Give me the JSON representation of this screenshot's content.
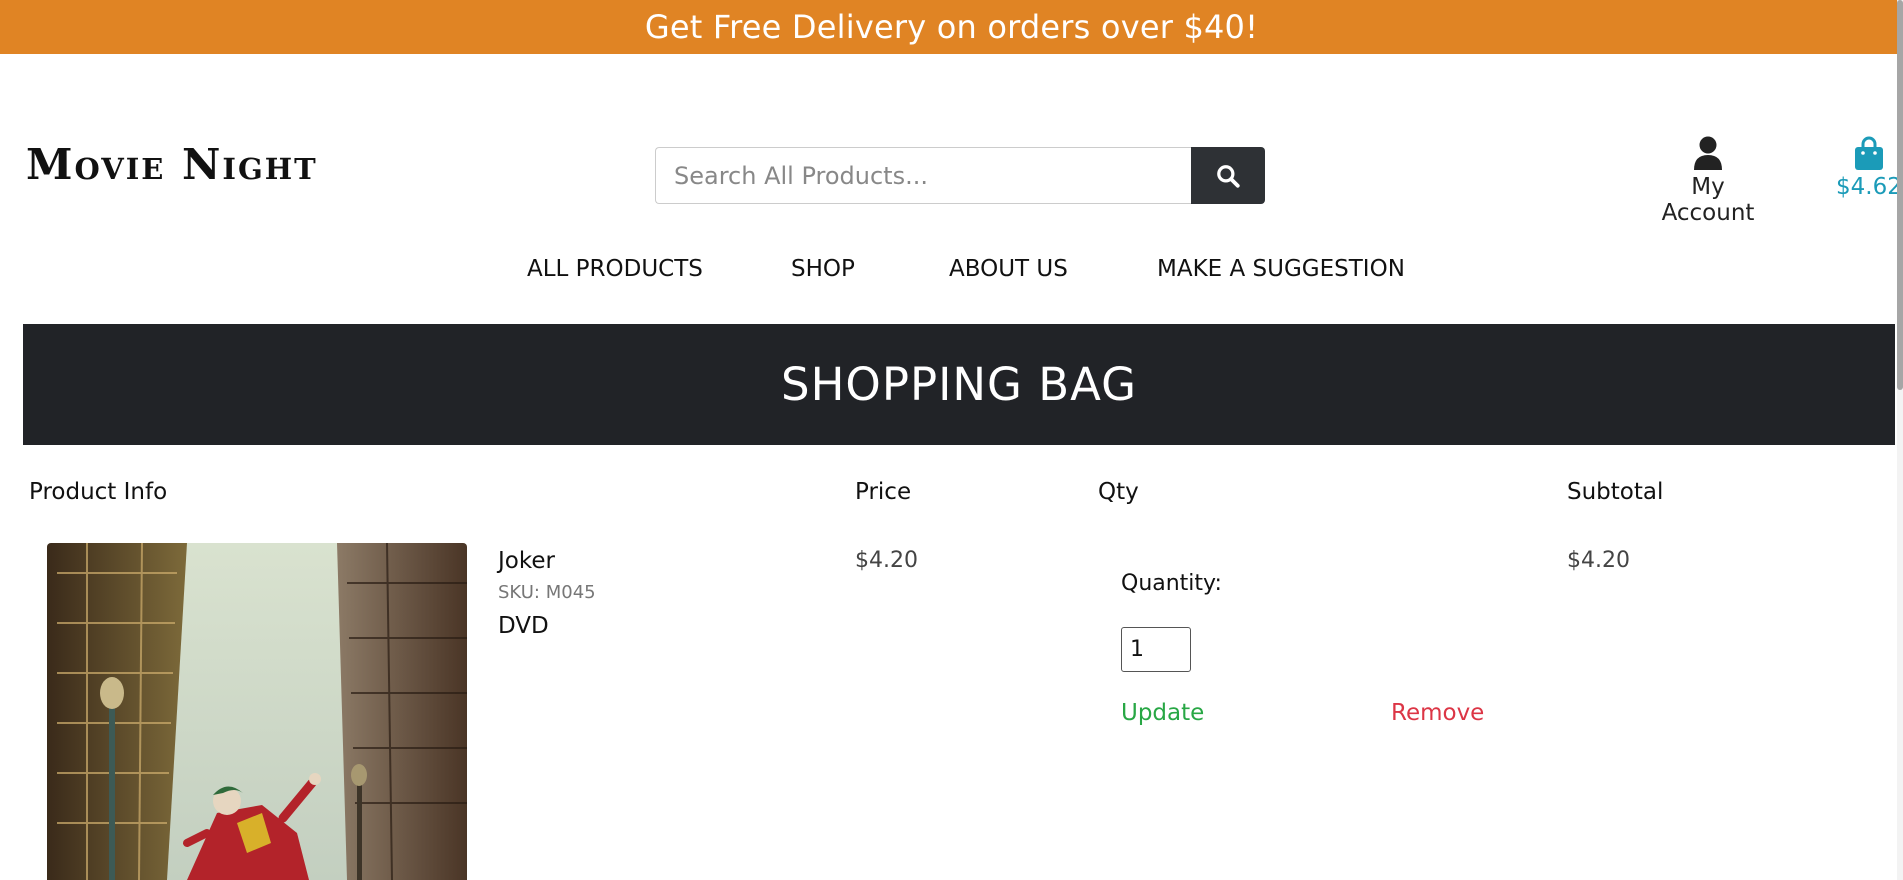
{
  "promo": {
    "text": "Get Free Delivery on orders over $40!"
  },
  "brand": {
    "logo": "Movie Night"
  },
  "search": {
    "placeholder": "Search All Products...",
    "value": ""
  },
  "account": {
    "label": "My Account",
    "icon": "user-icon"
  },
  "bag": {
    "amount": "$4.62",
    "icon": "shopping-bag-icon"
  },
  "nav": {
    "items": [
      {
        "label": "ALL PRODUCTS"
      },
      {
        "label": "SHOP"
      },
      {
        "label": "ABOUT US"
      },
      {
        "label": "MAKE A SUGGESTION"
      }
    ]
  },
  "page": {
    "title": "SHOPPING BAG"
  },
  "table": {
    "headers": {
      "product": "Product Info",
      "price": "Price",
      "qty": "Qty",
      "subtotal": "Subtotal"
    },
    "rows": [
      {
        "name": "Joker",
        "sku": "SKU: M045",
        "format": "DVD",
        "price": "$4.20",
        "quantity_label": "Quantity:",
        "quantity": "1",
        "update_label": "Update",
        "remove_label": "Remove",
        "subtotal": "$4.20"
      }
    ]
  },
  "colors": {
    "promo_bg": "#e08424",
    "header_bg": "#212327",
    "bag_accent": "#1b9bb8",
    "update": "#28a745",
    "remove": "#dc3545"
  }
}
